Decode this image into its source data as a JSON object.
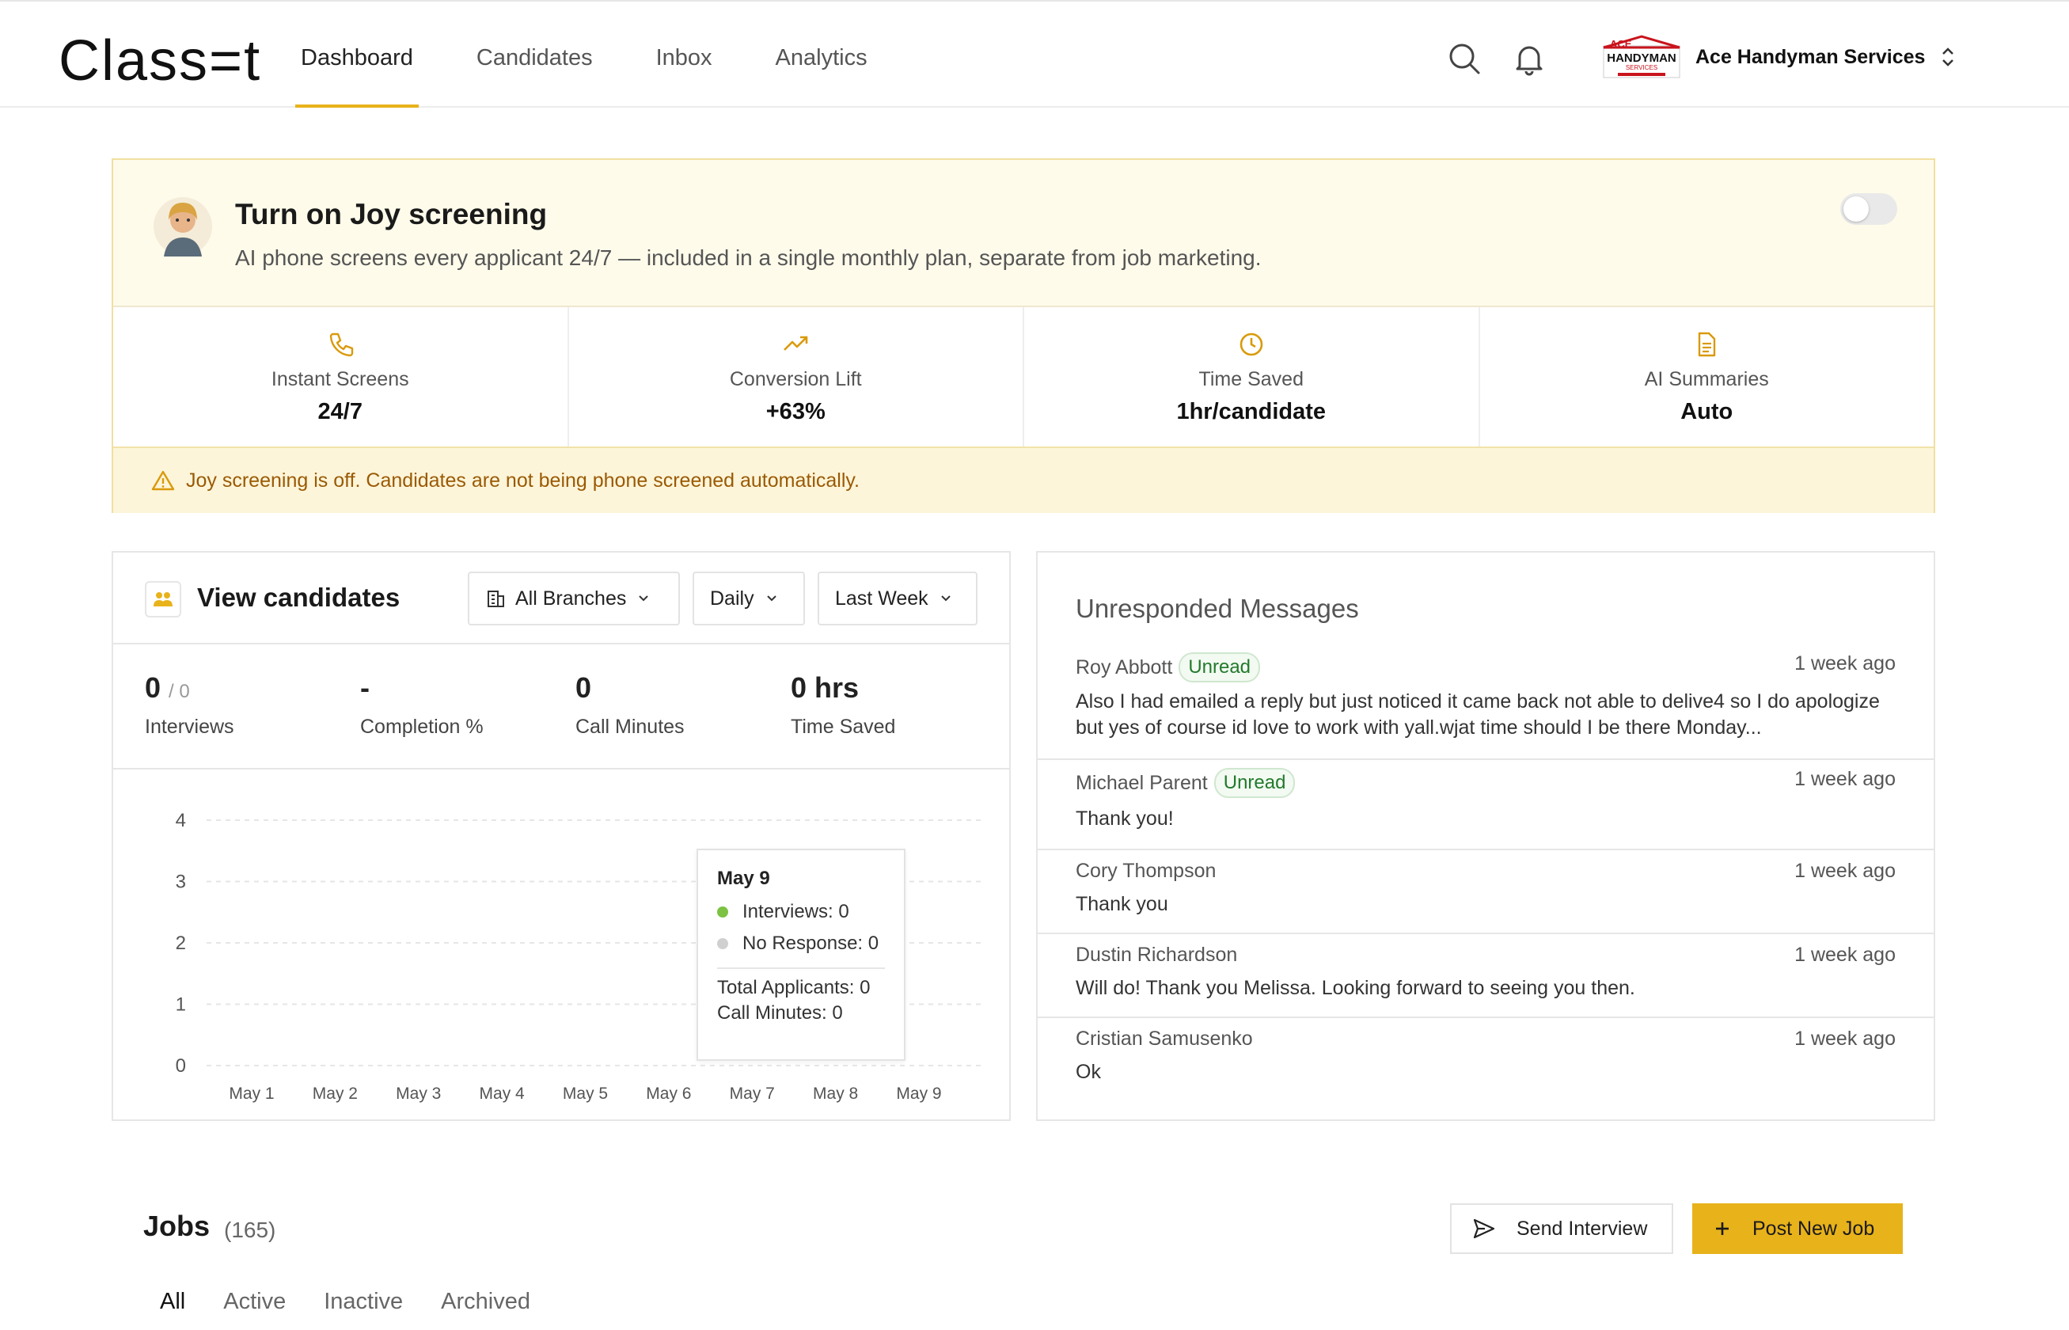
{
  "app": {
    "logo": "Class=t"
  },
  "nav": {
    "tabs": [
      "Dashboard",
      "Candidates",
      "Inbox",
      "Analytics"
    ],
    "active_tab": "Dashboard",
    "company": {
      "name": "Ace Handyman Services",
      "logo_text": "ACE HANDYMAN SERVICES"
    }
  },
  "joy": {
    "title": "Turn on Joy screening",
    "subtitle": "AI phone screens every applicant 24/7 — included in a single monthly plan, separate from job marketing.",
    "toggle_on": false,
    "stats": [
      {
        "icon": "phone-icon",
        "label": "Instant Screens",
        "value": "24/7"
      },
      {
        "icon": "trending-up-icon",
        "label": "Conversion Lift",
        "value": "+63%"
      },
      {
        "icon": "clock-icon",
        "label": "Time Saved",
        "value": "1hr/candidate"
      },
      {
        "icon": "document-icon",
        "label": "AI Summaries",
        "value": "Auto"
      }
    ],
    "warning": "Joy screening is off. Candidates are not being phone screened automatically.",
    "accent": "#e8b21b",
    "warning_color": "#9a5a05"
  },
  "candidates": {
    "title": "View candidates",
    "filters": {
      "branches": "All Branches",
      "interval": "Daily",
      "range": "Last Week"
    },
    "metrics": [
      {
        "value": "0",
        "suffix": "/ 0",
        "label": "Interviews"
      },
      {
        "value": "-",
        "suffix": "",
        "label": "Completion %"
      },
      {
        "value": "0",
        "suffix": "",
        "label": "Call Minutes"
      },
      {
        "value": "0 hrs",
        "suffix": "",
        "label": "Time Saved"
      }
    ],
    "tooltip": {
      "date": "May 9",
      "interviews": "Interviews: 0",
      "no_response": "No Response: 0",
      "total_applicants": "Total Applicants: 0",
      "call_minutes": "Call Minutes: 0"
    }
  },
  "chart_data": {
    "type": "bar",
    "categories": [
      "May 1",
      "May 2",
      "May 3",
      "May 4",
      "May 5",
      "May 6",
      "May 7",
      "May 8",
      "May 9"
    ],
    "series": [
      {
        "name": "Interviews",
        "values": [
          0,
          0,
          0,
          0,
          0,
          0,
          0,
          0,
          0
        ],
        "color": "#7cc243"
      },
      {
        "name": "No Response",
        "values": [
          0,
          0,
          0,
          0,
          0,
          0,
          0,
          0,
          0
        ],
        "color": "#d0d0d0"
      }
    ],
    "yticks": [
      0,
      1,
      2,
      3,
      4
    ],
    "ylim": [
      0,
      4
    ],
    "grid": true
  },
  "messages": {
    "title": "Unresponded Messages",
    "items": [
      {
        "name": "Roy Abbott",
        "badge": "Unread",
        "time": "1 week ago",
        "body": "Also I had emailed a reply but just noticed it came back not able to delive4 so I do apologize but yes of course id love to work with yall.wjat time should I be there Monday..."
      },
      {
        "name": "Michael Parent",
        "badge": "Unread",
        "time": "1 week ago",
        "body": "Thank you!"
      },
      {
        "name": "Cory Thompson",
        "badge": "",
        "time": "1 week ago",
        "body": "Thank you"
      },
      {
        "name": "Dustin Richardson",
        "badge": "",
        "time": "1 week ago",
        "body": "Will do! Thank you Melissa. Looking forward to seeing you then."
      },
      {
        "name": "Cristian Samusenko",
        "badge": "",
        "time": "1 week ago",
        "body": "Ok"
      }
    ]
  },
  "jobs": {
    "title": "Jobs",
    "count": "(165)",
    "send_label": "Send Interview",
    "post_label": "Post New Job",
    "tabs": [
      "All",
      "Active",
      "Inactive",
      "Archived"
    ],
    "active_tab": "All"
  }
}
